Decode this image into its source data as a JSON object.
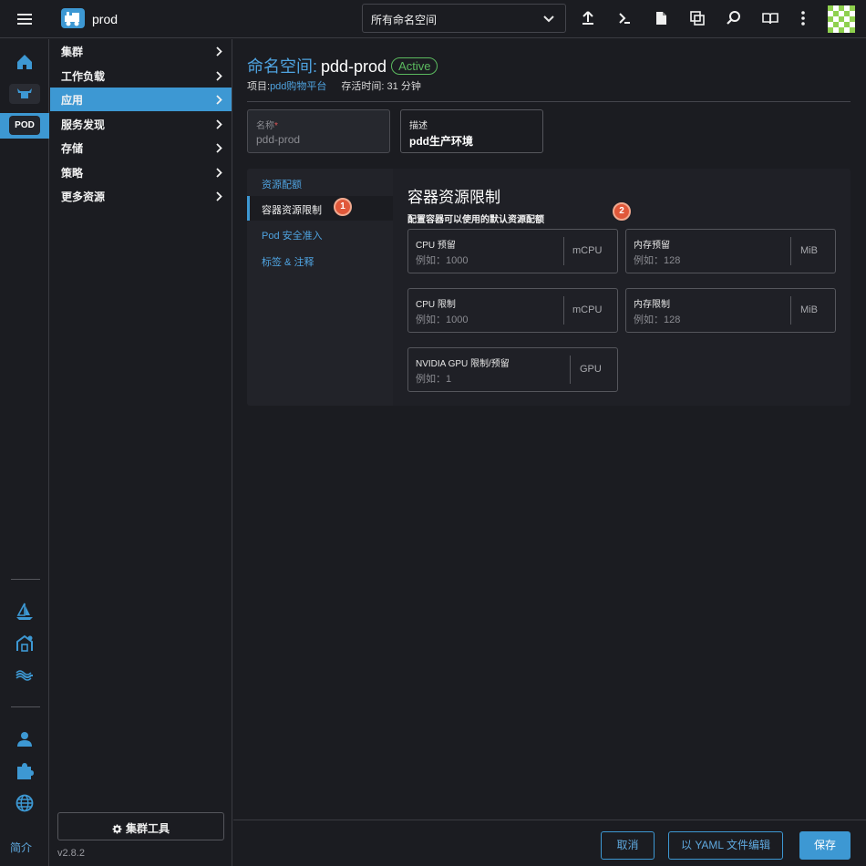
{
  "header": {
    "brand_name": "prod",
    "namespace_select": "所有命名空间",
    "icons": [
      "upload-icon",
      "terminal-icon",
      "file-icon",
      "copy-icon",
      "search-icon",
      "book-icon",
      "more-vertical-icon"
    ]
  },
  "rail": {
    "badge": "POD",
    "intro_label": "简介"
  },
  "sidebar": {
    "items": [
      {
        "label": "集群",
        "active": false
      },
      {
        "label": "工作负载",
        "active": false
      },
      {
        "label": "应用",
        "active": true
      },
      {
        "label": "服务发现",
        "active": false
      },
      {
        "label": "存储",
        "active": false
      },
      {
        "label": "策略",
        "active": false
      },
      {
        "label": "更多资源",
        "active": false
      }
    ],
    "tools_button": "集群工具",
    "version": "v2.8.2"
  },
  "page": {
    "title_prefix": "命名空间:",
    "title_name": "pdd-prod",
    "status": "Active",
    "project_label": "项目:",
    "project_name": "pdd购物平台",
    "age": "存活时间: 31 分钟"
  },
  "form": {
    "name_label": "名称",
    "name_required": "*",
    "name_value": "pdd-prod",
    "desc_label": "描述",
    "desc_value": "pdd生产环境"
  },
  "tabs": [
    {
      "label": "资源配额",
      "active": false
    },
    {
      "label": "容器资源限制",
      "active": true
    },
    {
      "label": "Pod 安全准入",
      "active": false
    },
    {
      "label": "标签 & 注释",
      "active": false
    }
  ],
  "steps": [
    "1",
    "2"
  ],
  "panel": {
    "title": "容器资源限制",
    "subtitle": "配置容器可以使用的默认资源配额",
    "inputs": [
      {
        "label": "CPU 预留",
        "placeholder": "例如：1000",
        "unit": "mCPU"
      },
      {
        "label": "内存预留",
        "placeholder": "例如：128",
        "unit": "MiB"
      },
      {
        "label": "CPU 限制",
        "placeholder": "例如：1000",
        "unit": "mCPU"
      },
      {
        "label": "内存限制",
        "placeholder": "例如：128",
        "unit": "MiB"
      },
      {
        "label": "NVIDIA GPU 限制/预留",
        "placeholder": "例如：1",
        "unit": "GPU"
      }
    ]
  },
  "footer": {
    "cancel": "取消",
    "yaml": "以 YAML 文件编辑",
    "save": "保存"
  },
  "colors": {
    "accent": "#3d98d3",
    "link": "#4fa3e0",
    "status_active": "#5bb95f",
    "step_badge": "#e0583a"
  }
}
